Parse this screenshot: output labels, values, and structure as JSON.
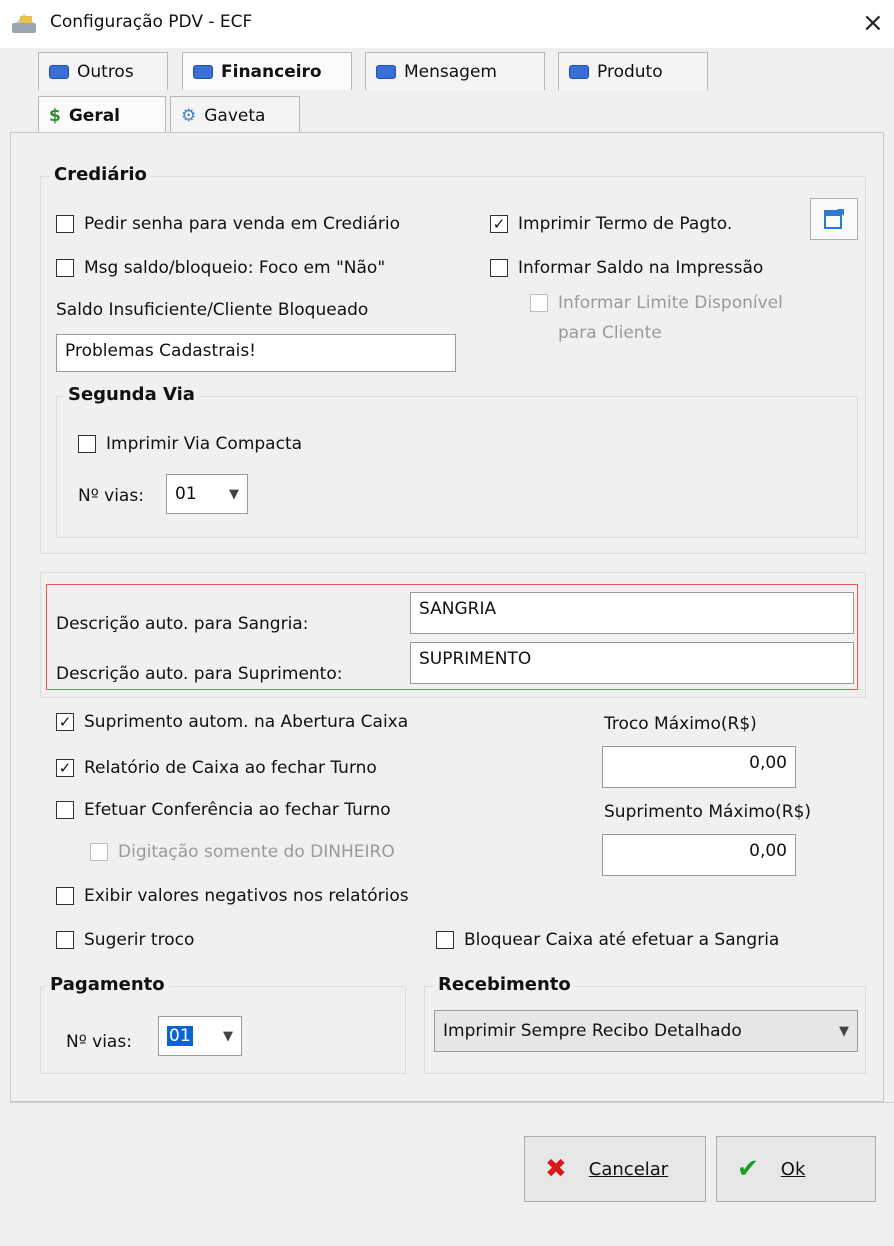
{
  "window": {
    "title": "Configuração PDV - ECF",
    "close": "×"
  },
  "tabs_top": [
    {
      "label": "Outros"
    },
    {
      "label": "Financeiro"
    },
    {
      "label": "Mensagem"
    },
    {
      "label": "Produto"
    }
  ],
  "tabs_sub": [
    {
      "label": "Geral",
      "icon": "$"
    },
    {
      "label": "Gaveta",
      "icon": "⚙"
    }
  ],
  "crediario": {
    "title": "Crediário",
    "pedir_senha": {
      "label": "Pedir senha para venda em Crediário",
      "checked": false
    },
    "msg_saldo": {
      "label": "Msg saldo/bloqueio: Foco em \"Não\"",
      "checked": false
    },
    "saldo_label": "Saldo Insuficiente/Cliente Bloqueado",
    "saldo_value": "Problemas Cadastrais!",
    "imprimir_termo": {
      "label": "Imprimir Termo de Pagto.",
      "checked": true
    },
    "informar_saldo": {
      "label": "Informar Saldo na Impressão",
      "checked": false
    },
    "informar_limite_line1": "Informar Limite Disponível",
    "informar_limite_line2": "para Cliente"
  },
  "segunda_via": {
    "title": "Segunda Via",
    "imprimir_compacta": {
      "label": "Imprimir Via Compacta",
      "checked": false
    },
    "vias_label": "Nº vias:",
    "vias_value": "01"
  },
  "descricao": {
    "sangria_label": "Descrição auto. para Sangria:",
    "sangria_value": "SANGRIA",
    "suprimento_label": "Descrição auto. para Suprimento:",
    "suprimento_value": "SUPRIMENTO"
  },
  "caixa": {
    "suprimento_autom": {
      "label": "Suprimento autom. na Abertura Caixa",
      "checked": true
    },
    "relatorio_caixa": {
      "label": "Relatório de Caixa ao fechar Turno",
      "checked": true
    },
    "efetuar_conferencia": {
      "label": "Efetuar Conferência ao fechar Turno",
      "checked": false
    },
    "digitacao_dinheiro": {
      "label": "Digitação somente do DINHEIRO",
      "checked": false
    },
    "exibir_negativos": {
      "label": "Exibir valores negativos nos relatórios",
      "checked": false
    },
    "sugerir_troco": {
      "label": "Sugerir troco",
      "checked": false
    },
    "bloquear_caixa": {
      "label": "Bloquear Caixa até efetuar a Sangria",
      "checked": false
    },
    "troco_max_label": "Troco Máximo(R$)",
    "troco_max_value": "0,00",
    "suprimento_max_label": "Suprimento Máximo(R$)",
    "suprimento_max_value": "0,00"
  },
  "pagamento": {
    "title": "Pagamento",
    "vias_label": "Nº vias:",
    "vias_value": "01"
  },
  "recebimento": {
    "title": "Recebimento",
    "option": "Imprimir Sempre Recibo Detalhado"
  },
  "buttons": {
    "cancelar": "Cancelar",
    "ok": "Ok"
  },
  "colors": {
    "accent": "#3b6fd8",
    "red": "#e05b5b",
    "cancel_icon": "#d61a1a",
    "ok_icon": "#1e9a2a"
  }
}
